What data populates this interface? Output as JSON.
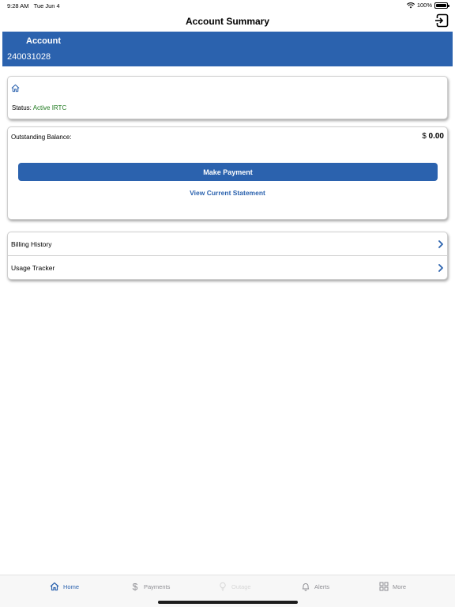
{
  "status_bar": {
    "time": "9:28 AM",
    "date": "Tue Jun 4",
    "battery": "100%",
    "battery_level": 1.0
  },
  "nav": {
    "title": "Account Summary",
    "logout_icon": "logout-icon"
  },
  "account": {
    "label": "Account",
    "number": "240031028"
  },
  "status_card": {
    "icon": "home-icon",
    "status_label": "Status:",
    "status_value": "Active IRTC"
  },
  "balance_card": {
    "label": "Outstanding Balance:",
    "currency": "$",
    "amount": "0.00",
    "make_payment_label": "Make Payment",
    "view_statement_label": "View Current Statement"
  },
  "menu": {
    "items": [
      {
        "label": "Billing History",
        "icon": "chevron-right-icon"
      },
      {
        "label": "Usage Tracker",
        "icon": "chevron-right-icon"
      }
    ]
  },
  "tab_bar": {
    "tabs": [
      {
        "label": "Home",
        "icon": "home-icon",
        "state": "active"
      },
      {
        "label": "Payments",
        "icon": "dollar-icon",
        "state": "normal"
      },
      {
        "label": "Outage",
        "icon": "bulb-icon",
        "state": "disabled"
      },
      {
        "label": "Alerts",
        "icon": "bell-icon",
        "state": "normal"
      },
      {
        "label": "More",
        "icon": "grid-icon",
        "state": "normal"
      }
    ]
  },
  "colors": {
    "primary": "#2b62ae",
    "status_active": "#1f7a1f",
    "tab_inactive": "#8e8e93",
    "tab_disabled": "#d7d7d7"
  }
}
